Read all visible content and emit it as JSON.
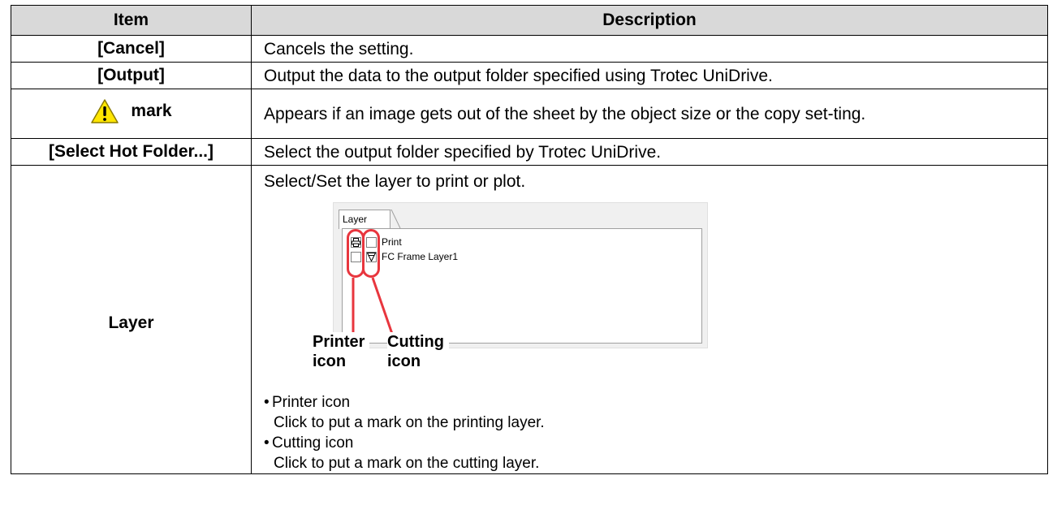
{
  "table": {
    "headers": {
      "item": "Item",
      "description": "Description"
    },
    "rows": [
      {
        "item": "[Cancel]",
        "description": "Cancels the setting."
      },
      {
        "item": "[Output]",
        "description": "Output the data to the output folder specified using Trotec UniDrive."
      },
      {
        "item": "mark",
        "icon": "warning-triangle-icon",
        "description": "Appears if an image gets out of the sheet by the object size or the copy set-ting."
      },
      {
        "item": "[Select Hot Folder...]",
        "description": "Select the output folder specified by Trotec UniDrive."
      },
      {
        "item": "Layer",
        "description": "Select/Set the layer to print or plot."
      }
    ]
  },
  "layer_figure": {
    "tab_label": "Layer",
    "layers": [
      {
        "name": "Print",
        "printer_icon": true,
        "cutting_icon": false
      },
      {
        "name": "FC Frame Layer1",
        "printer_icon": false,
        "cutting_icon": true
      }
    ],
    "callout_printer": "Printer icon",
    "callout_printer_line1": "Printer",
    "callout_printer_line2": "icon",
    "callout_cutting_line1": "Cutting",
    "callout_cutting_line2": "icon",
    "highlight_color": "#e8363e"
  },
  "notes": [
    {
      "title": "Printer icon",
      "text": "Click to put a mark on the printing layer."
    },
    {
      "title": "Cutting icon",
      "text": "Click to put a mark on the cutting layer."
    }
  ],
  "colors": {
    "header_bg": "#d9d9d9",
    "warning_fill": "#ffe600"
  }
}
